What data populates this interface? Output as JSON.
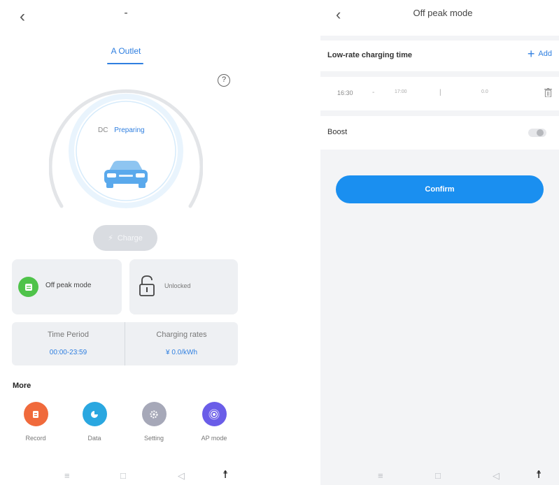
{
  "left": {
    "header": {
      "title": "-"
    },
    "outlet_tab": "A Outlet",
    "charger": {
      "mode": "DC",
      "status": "Preparing"
    },
    "charge_button": "Charge",
    "cards": {
      "off_peak": "Off peak mode",
      "lock": "Unlocked"
    },
    "info": {
      "time_period_label": "Time Period",
      "time_period_value": "00:00-23:59",
      "rates_label": "Charging rates",
      "rates_value": "¥ 0.0/kWh"
    },
    "more": {
      "title": "More",
      "items": [
        {
          "label": "Record",
          "icon": "record-icon",
          "color": "#f06a3c"
        },
        {
          "label": "Data",
          "icon": "data-icon",
          "color": "#2aa7e0"
        },
        {
          "label": "Setting",
          "icon": "gear-icon",
          "color": "#a6a8b8"
        },
        {
          "label": "AP mode",
          "icon": "ap-mode-icon",
          "color": "#6a5de8"
        }
      ]
    }
  },
  "right": {
    "header": {
      "title": "Off peak mode"
    },
    "section": {
      "label": "Low-rate charging time",
      "add_label": "Add"
    },
    "period_row": {
      "start": "16:30",
      "separator": "-",
      "end": "17:00",
      "rate_separator": "|",
      "rate": "0.0"
    },
    "boost": {
      "label": "Boost"
    },
    "confirm_label": "Confirm"
  },
  "colors": {
    "accent": "#1a8ff0",
    "off_peak_green": "#4fc34a",
    "link_blue": "#2f7fe0"
  }
}
